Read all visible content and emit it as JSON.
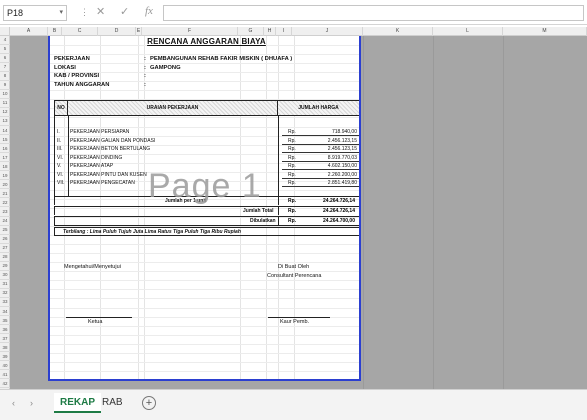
{
  "formula_bar": {
    "name_box": "P18",
    "dropdown_glyph": "▾",
    "separator": "⋮",
    "cancel_glyph": "✕",
    "enter_glyph": "✓",
    "function_glyph": "fx",
    "formula": ""
  },
  "columns": [
    "A",
    "B",
    "C",
    "D",
    "E",
    "F",
    "G",
    "H",
    "I",
    "J",
    "K",
    "L",
    "M"
  ],
  "rows": [
    "4",
    "5",
    "6",
    "7",
    "8",
    "9",
    "10",
    "11",
    "12",
    "13",
    "14",
    "15",
    "16",
    "17",
    "18",
    "19",
    "20",
    "21",
    "22",
    "23",
    "24",
    "25",
    "26",
    "27",
    "28",
    "29",
    "30",
    "31",
    "32",
    "33",
    "34",
    "35",
    "36",
    "37",
    "38",
    "39",
    "40",
    "41",
    "42"
  ],
  "sheet": {
    "title": "RENCANA ANGGARAN BIAYA",
    "info": [
      {
        "label": "PEKERJAAN",
        "value": "PEMBANGUNAN REHAB FAKIR MISKIN ( DHUAFA )"
      },
      {
        "label": "LOKASI",
        "value": "GAMPONG"
      },
      {
        "label": "KAB / PROVINSI",
        "value": ""
      },
      {
        "label": "TAHUN ANGGARAN",
        "value": ""
      }
    ],
    "info_colon": ":",
    "table_header": {
      "no": "NO",
      "uraian": "URAIAN PEKERJAAN",
      "jumlah": "JUMLAH HARGA"
    },
    "items": [
      {
        "no": "I.",
        "desc": "PEKERJAAN PERSIAPAN",
        "rp": "Rp.",
        "value": "718.940,00"
      },
      {
        "no": "II.",
        "desc": "PEKERJAAN GALIAN DAN PONDASI",
        "rp": "Rp.",
        "value": "2.456.123,15"
      },
      {
        "no": "III.",
        "desc": "PEKERJAAN BETON BERTULANG",
        "rp": "Rp.",
        "value": "2.456.123,15"
      },
      {
        "no": "VI.",
        "desc": "PEKERJAAN DINDING",
        "rp": "Rp.",
        "value": "8.919.770,03"
      },
      {
        "no": "V.",
        "desc": "PEKERJAAN ATAP",
        "rp": "Rp.",
        "value": "4.602.150,00"
      },
      {
        "no": "VI.",
        "desc": "PEKERJAAN PINTU DAN KUSEN",
        "rp": "Rp.",
        "value": "2.260.200,00"
      },
      {
        "no": "VII.",
        "desc": "PEKERJAAN PENGECATAN",
        "rp": "Rp.",
        "value": "2.851.419,80"
      }
    ],
    "totals": [
      {
        "label": "Jumlah per 1 unit",
        "rp": "Rp.",
        "value": "24.264.726,14"
      },
      {
        "label": "Jumlah Total",
        "rp": "Rp.",
        "value": "24.264.726,14"
      },
      {
        "label": "Dibulatkan",
        "rp": "Rp.",
        "value": "24.264.700,00"
      }
    ],
    "terbilang": "Terbilang :  Lima Puluh Tujuh Juta Lima Ratus Tiga Puluh Tiga Ribu Rupiah",
    "signatures": {
      "left_header": "Mengetahui/Menyetujui",
      "right_header": "Di Buat Oleh",
      "right_sub": "Consultant Perencana",
      "left_role": "Ketua",
      "right_role": "Kaur Pemb."
    },
    "watermark": "Page 1"
  },
  "tabs": {
    "prev_glyph": "‹",
    "next_glyph": "›",
    "items": [
      {
        "label": "REKAP",
        "active": true
      },
      {
        "label": "RAB",
        "active": false
      }
    ],
    "add_glyph": "+"
  },
  "colors": {
    "page_border": "#2b3fd0",
    "non_print_area": "#a6a6a6",
    "active_tab": "#1e7b45"
  }
}
